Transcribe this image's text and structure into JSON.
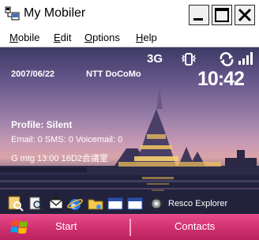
{
  "window": {
    "title": "My Mobiler"
  },
  "menu": {
    "items": [
      {
        "label": "Mobile",
        "accel": "M",
        "rest": "obile"
      },
      {
        "label": "Edit",
        "accel": "E",
        "rest": "dit"
      },
      {
        "label": "Options",
        "accel": "O",
        "rest": "ptions"
      },
      {
        "label": "Help",
        "accel": "H",
        "rest": "elp"
      }
    ]
  },
  "status": {
    "network_type": "3G",
    "icons": [
      "phone-vibrate-icon",
      "sync-icon",
      "signal-strength-icon"
    ]
  },
  "today": {
    "date": "2007/06/22",
    "carrier": "NTT DoCoMo",
    "time": "10:42",
    "profile": "Profile: Silent",
    "messages": "Email: 0 SMS: 0 Voicemail: 0",
    "appointment": "G mtg 13:00 16D2会議室"
  },
  "tray": {
    "label": "Resco Explorer",
    "icons": [
      "search-icon",
      "magnify-doc-icon",
      "mail-icon",
      "internet-explorer-icon",
      "folder-icon",
      "window-icon",
      "window-icon",
      "settings-icon"
    ]
  },
  "softkeys": {
    "left": "Start",
    "right": "Contacts"
  },
  "colors": {
    "softbar": "#d0306f",
    "title_bg": "#ffffff"
  }
}
